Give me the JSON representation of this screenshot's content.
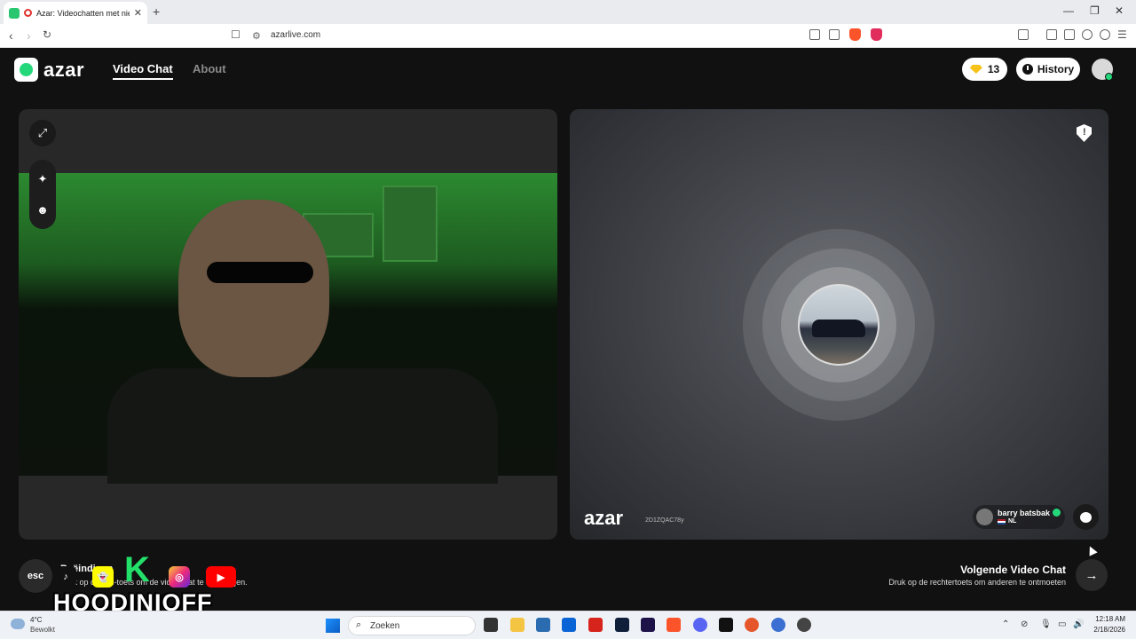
{
  "browser": {
    "tab_title": "Azar: Videochatten met nieuwe",
    "tab_close": "✕",
    "new_tab": "+",
    "url": "azarlive.com",
    "minimize": "—",
    "restore": "❐",
    "close": "✕"
  },
  "header": {
    "logo_text": "azar",
    "nav_video_chat": "Video Chat",
    "nav_about": "About",
    "gems_count": "13",
    "history_label": "History"
  },
  "left_panel": {
    "expand_icon": "⤢",
    "effects_icon": "✦",
    "sticker_icon": "☻"
  },
  "right_panel": {
    "logo_text": "azar",
    "session_id": "2D1ZQAC78y",
    "peer_name": "barry batsbak",
    "peer_country": "NL",
    "report_icon": "!"
  },
  "bottom": {
    "esc_label": "esc",
    "end_title": "Beëindigen",
    "end_subtitle": "Druk op de esc-toets om de videochat te beëindigen.",
    "next_title": "Volgende Video Chat",
    "next_subtitle": "Druk op de rechtertoets om anderen te ontmoeten",
    "next_arrow": "→"
  },
  "overlay": {
    "letter": "K",
    "name": "HOODINIOFF",
    "tiktok": "♪",
    "snapchat": "👻",
    "instagram": "◎",
    "youtube": "▶"
  },
  "taskbar": {
    "temperature": "4°C",
    "condition": "Bewolkt",
    "search_placeholder": "Zoeken",
    "time": "12:18 AM",
    "date": "2/18/2026"
  },
  "colors": {
    "accent_green": "#23d77a",
    "background": "#111111",
    "panel": "#282828",
    "gem": "#f7c21a"
  }
}
